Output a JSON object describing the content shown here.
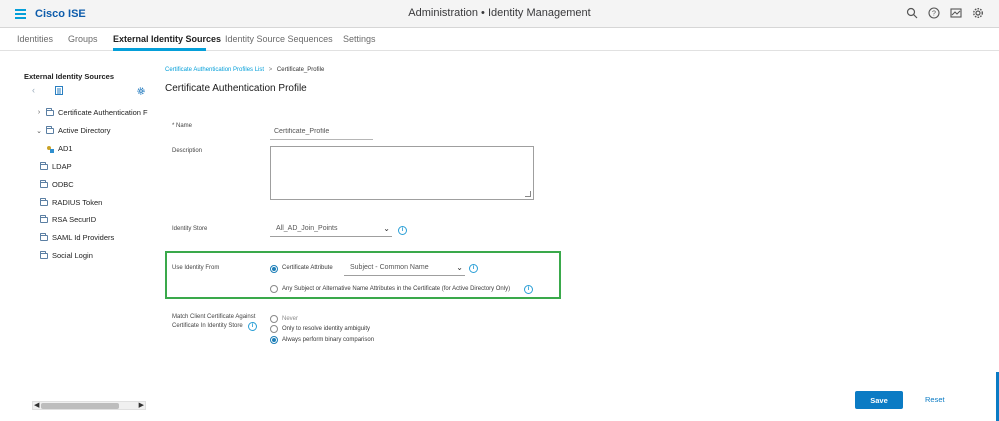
{
  "app": {
    "brand": "Cisco ISE",
    "title": "Administration • Identity Management",
    "icons": [
      "search-icon",
      "help-icon",
      "dashboard-icon",
      "gear-icon"
    ]
  },
  "tabs": [
    {
      "label": "Identities"
    },
    {
      "label": "Groups"
    },
    {
      "label": "External Identity Sources",
      "active": true
    },
    {
      "label": "Identity Source Sequences"
    },
    {
      "label": "Settings"
    }
  ],
  "sidebar": {
    "title": "External Identity Sources",
    "items": [
      {
        "label": "Certificate Authentication F"
      },
      {
        "label": "Active Directory"
      },
      {
        "label": "AD1"
      },
      {
        "label": "LDAP"
      },
      {
        "label": "ODBC"
      },
      {
        "label": "RADIUS Token"
      },
      {
        "label": "RSA SecurID"
      },
      {
        "label": "SAML Id Providers"
      },
      {
        "label": "Social Login"
      }
    ]
  },
  "breadcrumb": {
    "link": "Certificate Authentication Profiles List",
    "separator": ">",
    "current": "Certificate_Profile"
  },
  "page_title": "Certificate Authentication Profile",
  "form": {
    "name_label": "* Name",
    "name_value": "Certificate_Profile",
    "description_label": "Description",
    "identity_store_label": "Identity Store",
    "identity_store_value": "All_AD_Join_Points",
    "use_identity_from_label": "Use Identity From",
    "use_identity_options": [
      {
        "label": "Certificate Attribute",
        "selected": true
      },
      {
        "label": "Any Subject or Alternative Name Attributes in the Certificate (for Active Directory Only)",
        "selected": false
      }
    ],
    "certificate_attribute_value": "Subject - Common Name",
    "match_label_line1": "Match Client Certificate Against",
    "match_label_line2": "Certificate In Identity Store",
    "match_options": [
      {
        "label": "Never",
        "selected": false
      },
      {
        "label": "Only to resolve identity ambiguity",
        "selected": false
      },
      {
        "label": "Always perform binary comparison",
        "selected": true
      }
    ]
  },
  "actions": {
    "save_label": "Save",
    "reset_label": "Reset"
  },
  "colors": {
    "accent": "#049fd9",
    "primary_button": "#0b7bc4",
    "highlight_box": "#3aa94b"
  }
}
